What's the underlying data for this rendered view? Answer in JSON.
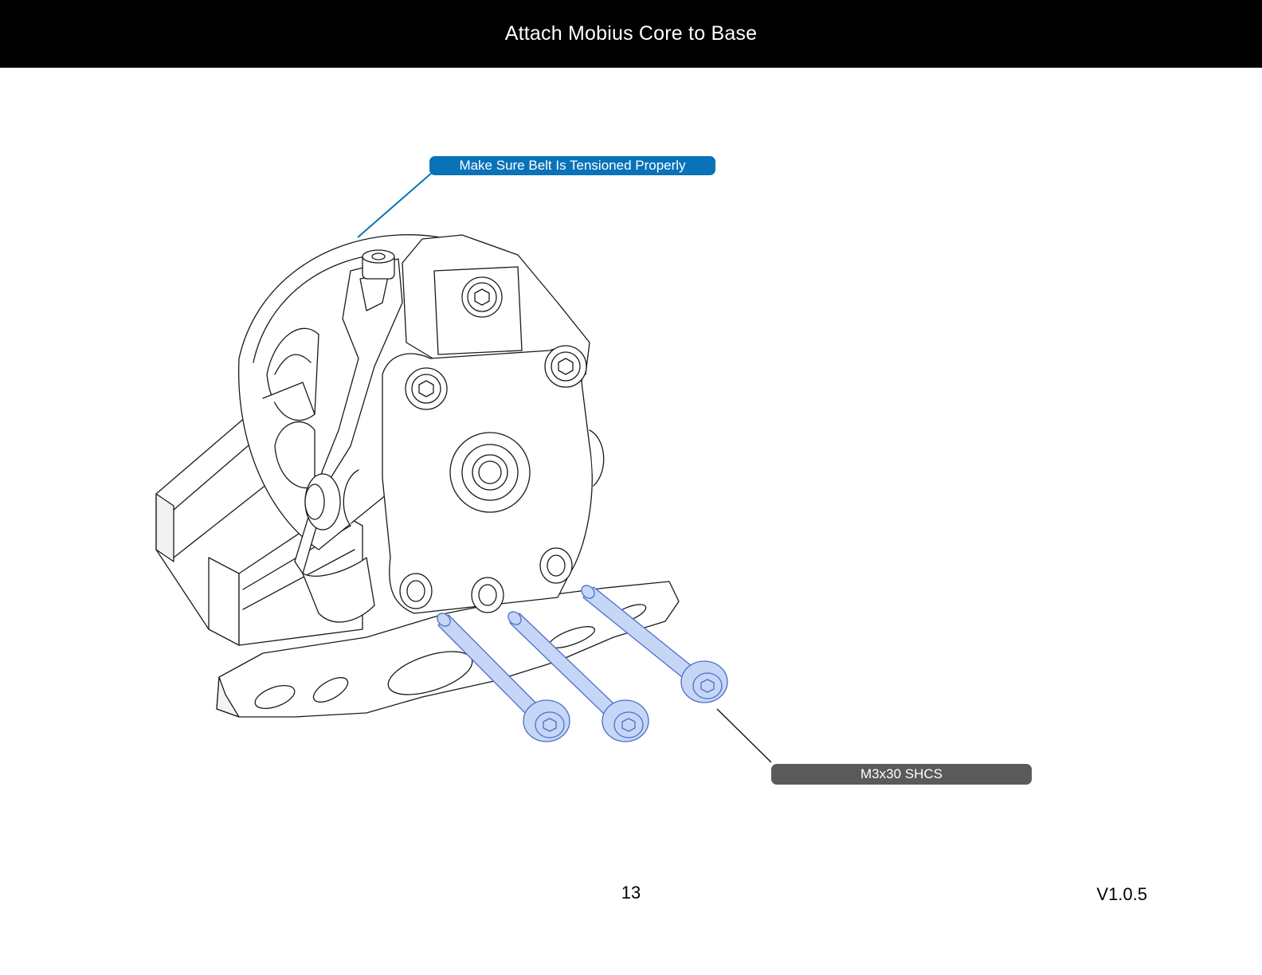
{
  "header": {
    "title": "Attach Mobius Core to Base"
  },
  "callouts": {
    "belt_note": "Make Sure Belt Is Tensioned Properly",
    "screw_note": "M3x30 SHCS"
  },
  "footer": {
    "page_number": "13",
    "version": "V1.0.5"
  },
  "colors": {
    "header_bg": "#000000",
    "belt_callout": "#0a72b8",
    "screw_callout": "#5a5a5a",
    "screw_highlight": "#c6d6f7"
  },
  "screw_count": 3
}
